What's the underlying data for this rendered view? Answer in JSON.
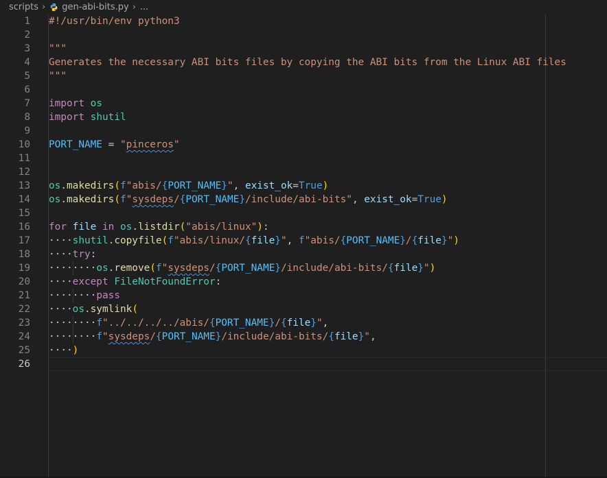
{
  "breadcrumb": {
    "folder": "scripts",
    "file": "gen-abi-bits.py",
    "symbol": "..."
  },
  "editor": {
    "line_numbers": [
      "1",
      "2",
      "3",
      "4",
      "5",
      "6",
      "7",
      "8",
      "9",
      "10",
      "11",
      "12",
      "13",
      "14",
      "15",
      "16",
      "17",
      "18",
      "19",
      "20",
      "21",
      "22",
      "23",
      "24",
      "25",
      "26"
    ],
    "active_line": "26",
    "lines": [
      {
        "tokens": [
          {
            "t": "#!/usr/bin/env python3",
            "c": "comment"
          }
        ]
      },
      {
        "tokens": []
      },
      {
        "tokens": [
          {
            "t": "\"\"\"",
            "c": "str"
          }
        ]
      },
      {
        "tokens": [
          {
            "t": "Generates the necessary ABI bits files by copying the ABI bits from the Linux ABI files",
            "c": "str"
          }
        ]
      },
      {
        "tokens": [
          {
            "t": "\"\"\"",
            "c": "str"
          }
        ]
      },
      {
        "tokens": []
      },
      {
        "tokens": [
          {
            "t": "import",
            "c": "kw"
          },
          {
            "t": " ",
            "c": "plain"
          },
          {
            "t": "os",
            "c": "cls"
          }
        ]
      },
      {
        "tokens": [
          {
            "t": "import",
            "c": "kw"
          },
          {
            "t": " ",
            "c": "plain"
          },
          {
            "t": "shutil",
            "c": "cls"
          }
        ]
      },
      {
        "tokens": []
      },
      {
        "tokens": [
          {
            "t": "PORT_NAME",
            "c": "const"
          },
          {
            "t": " = ",
            "c": "plain"
          },
          {
            "t": "\"",
            "c": "str"
          },
          {
            "t": "pinceros",
            "c": "str",
            "sq": true
          },
          {
            "t": "\"",
            "c": "str"
          }
        ]
      },
      {
        "tokens": []
      },
      {
        "tokens": []
      },
      {
        "tokens": [
          {
            "t": "os",
            "c": "cls"
          },
          {
            "t": ".",
            "c": "plain"
          },
          {
            "t": "makedirs",
            "c": "fn"
          },
          {
            "t": "(",
            "c": "p1"
          },
          {
            "t": "f",
            "c": "kw2"
          },
          {
            "t": "\"abis/",
            "c": "str"
          },
          {
            "t": "{",
            "c": "brace"
          },
          {
            "t": "PORT_NAME",
            "c": "const"
          },
          {
            "t": "}",
            "c": "brace"
          },
          {
            "t": "\"",
            "c": "str"
          },
          {
            "t": ", ",
            "c": "plain"
          },
          {
            "t": "exist_ok",
            "c": "var"
          },
          {
            "t": "=",
            "c": "plain"
          },
          {
            "t": "True",
            "c": "kw2"
          },
          {
            "t": ")",
            "c": "p1"
          }
        ]
      },
      {
        "tokens": [
          {
            "t": "os",
            "c": "cls"
          },
          {
            "t": ".",
            "c": "plain"
          },
          {
            "t": "makedirs",
            "c": "fn"
          },
          {
            "t": "(",
            "c": "p1"
          },
          {
            "t": "f",
            "c": "kw2"
          },
          {
            "t": "\"",
            "c": "str"
          },
          {
            "t": "sysdeps",
            "c": "str",
            "sq": true
          },
          {
            "t": "/",
            "c": "str"
          },
          {
            "t": "{",
            "c": "brace"
          },
          {
            "t": "PORT_NAME",
            "c": "const"
          },
          {
            "t": "}",
            "c": "brace"
          },
          {
            "t": "/include/abi-bits\"",
            "c": "str"
          },
          {
            "t": ", ",
            "c": "plain"
          },
          {
            "t": "exist_ok",
            "c": "var"
          },
          {
            "t": "=",
            "c": "plain"
          },
          {
            "t": "True",
            "c": "kw2"
          },
          {
            "t": ")",
            "c": "p1"
          }
        ]
      },
      {
        "tokens": []
      },
      {
        "tokens": [
          {
            "t": "for",
            "c": "kw"
          },
          {
            "t": " ",
            "c": "plain"
          },
          {
            "t": "file",
            "c": "var"
          },
          {
            "t": " ",
            "c": "plain"
          },
          {
            "t": "in",
            "c": "kw"
          },
          {
            "t": " ",
            "c": "plain"
          },
          {
            "t": "os",
            "c": "cls"
          },
          {
            "t": ".",
            "c": "plain"
          },
          {
            "t": "listdir",
            "c": "fn"
          },
          {
            "t": "(",
            "c": "p1"
          },
          {
            "t": "\"abis/linux\"",
            "c": "str"
          },
          {
            "t": ")",
            "c": "p1"
          },
          {
            "t": ":",
            "c": "plain"
          }
        ]
      },
      {
        "tokens": [
          {
            "t": "····",
            "c": "ws"
          },
          {
            "t": "shutil",
            "c": "cls"
          },
          {
            "t": ".",
            "c": "plain"
          },
          {
            "t": "copyfile",
            "c": "fn"
          },
          {
            "t": "(",
            "c": "p1"
          },
          {
            "t": "f",
            "c": "kw2"
          },
          {
            "t": "\"abis/linux/",
            "c": "str"
          },
          {
            "t": "{",
            "c": "brace"
          },
          {
            "t": "file",
            "c": "var"
          },
          {
            "t": "}",
            "c": "brace"
          },
          {
            "t": "\"",
            "c": "str"
          },
          {
            "t": ", ",
            "c": "plain"
          },
          {
            "t": "f",
            "c": "kw2"
          },
          {
            "t": "\"abis/",
            "c": "str"
          },
          {
            "t": "{",
            "c": "brace"
          },
          {
            "t": "PORT_NAME",
            "c": "const"
          },
          {
            "t": "}",
            "c": "brace"
          },
          {
            "t": "/",
            "c": "str"
          },
          {
            "t": "{",
            "c": "brace"
          },
          {
            "t": "file",
            "c": "var"
          },
          {
            "t": "}",
            "c": "brace"
          },
          {
            "t": "\"",
            "c": "str"
          },
          {
            "t": ")",
            "c": "p1"
          }
        ]
      },
      {
        "tokens": [
          {
            "t": "····",
            "c": "ws"
          },
          {
            "t": "try",
            "c": "kw"
          },
          {
            "t": ":",
            "c": "plain"
          }
        ]
      },
      {
        "tokens": [
          {
            "t": "········",
            "c": "ws"
          },
          {
            "t": "os",
            "c": "cls"
          },
          {
            "t": ".",
            "c": "plain"
          },
          {
            "t": "remove",
            "c": "fn"
          },
          {
            "t": "(",
            "c": "p1"
          },
          {
            "t": "f",
            "c": "kw2"
          },
          {
            "t": "\"",
            "c": "str"
          },
          {
            "t": "sysdeps",
            "c": "str",
            "sq": true
          },
          {
            "t": "/",
            "c": "str"
          },
          {
            "t": "{",
            "c": "brace"
          },
          {
            "t": "PORT_NAME",
            "c": "const"
          },
          {
            "t": "}",
            "c": "brace"
          },
          {
            "t": "/include/abi-bits/",
            "c": "str"
          },
          {
            "t": "{",
            "c": "brace"
          },
          {
            "t": "file",
            "c": "var"
          },
          {
            "t": "}",
            "c": "brace"
          },
          {
            "t": "\"",
            "c": "str"
          },
          {
            "t": ")",
            "c": "p1"
          }
        ]
      },
      {
        "tokens": [
          {
            "t": "····",
            "c": "ws"
          },
          {
            "t": "except",
            "c": "kw"
          },
          {
            "t": " ",
            "c": "plain"
          },
          {
            "t": "FileNotFoundError",
            "c": "cls"
          },
          {
            "t": ":",
            "c": "plain"
          }
        ]
      },
      {
        "tokens": [
          {
            "t": "········",
            "c": "ws"
          },
          {
            "t": "pass",
            "c": "kw"
          }
        ]
      },
      {
        "tokens": [
          {
            "t": "····",
            "c": "ws"
          },
          {
            "t": "os",
            "c": "cls"
          },
          {
            "t": ".",
            "c": "plain"
          },
          {
            "t": "symlink",
            "c": "fn"
          },
          {
            "t": "(",
            "c": "p1"
          }
        ]
      },
      {
        "tokens": [
          {
            "t": "········",
            "c": "ws"
          },
          {
            "t": "f",
            "c": "kw2"
          },
          {
            "t": "\"../../../../abis/",
            "c": "str"
          },
          {
            "t": "{",
            "c": "brace"
          },
          {
            "t": "PORT_NAME",
            "c": "const"
          },
          {
            "t": "}",
            "c": "brace"
          },
          {
            "t": "/",
            "c": "str"
          },
          {
            "t": "{",
            "c": "brace"
          },
          {
            "t": "file",
            "c": "var"
          },
          {
            "t": "}",
            "c": "brace"
          },
          {
            "t": "\"",
            "c": "str"
          },
          {
            "t": ",",
            "c": "plain"
          }
        ]
      },
      {
        "tokens": [
          {
            "t": "········",
            "c": "ws"
          },
          {
            "t": "f",
            "c": "kw2"
          },
          {
            "t": "\"",
            "c": "str"
          },
          {
            "t": "sysdeps",
            "c": "str",
            "sq": true
          },
          {
            "t": "/",
            "c": "str"
          },
          {
            "t": "{",
            "c": "brace"
          },
          {
            "t": "PORT_NAME",
            "c": "const"
          },
          {
            "t": "}",
            "c": "brace"
          },
          {
            "t": "/include/abi-bits/",
            "c": "str"
          },
          {
            "t": "{",
            "c": "brace"
          },
          {
            "t": "file",
            "c": "var"
          },
          {
            "t": "}",
            "c": "brace"
          },
          {
            "t": "\"",
            "c": "str"
          },
          {
            "t": ",",
            "c": "plain"
          }
        ]
      },
      {
        "tokens": [
          {
            "t": "····",
            "c": "ws"
          },
          {
            "t": ")",
            "c": "p1"
          }
        ]
      },
      {
        "tokens": []
      }
    ]
  },
  "colors": {
    "background": "#1f1f1f",
    "string": "#ce9178",
    "keyword": "#c586c0",
    "constant": "#4fc1ff",
    "class": "#4ec9b0",
    "function": "#dcdcaa"
  }
}
